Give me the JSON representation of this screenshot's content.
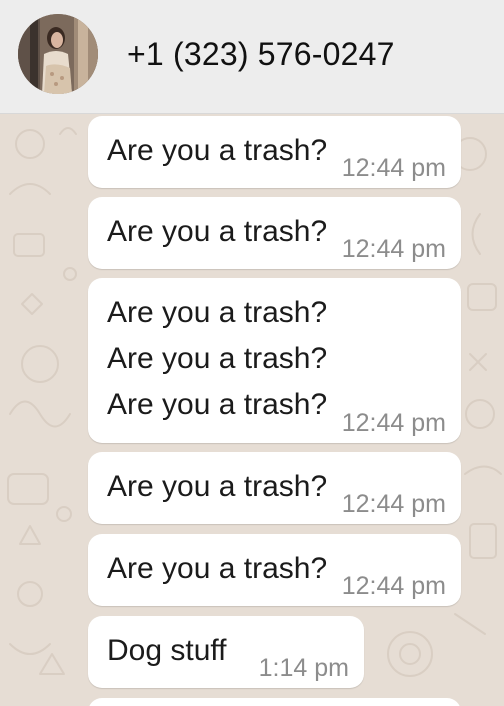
{
  "header": {
    "contact_name": "+1 (323) 576-0247"
  },
  "messages": [
    {
      "lines": [
        "Are you a trash?"
      ],
      "time": "12:44 pm"
    },
    {
      "lines": [
        "Are you a trash?"
      ],
      "time": "12:44 pm"
    },
    {
      "lines": [
        "Are you a trash?",
        "Are you a trash?",
        "Are you a trash?"
      ],
      "time": "12:44 pm"
    },
    {
      "lines": [
        "Are you a trash?"
      ],
      "time": "12:44 pm"
    },
    {
      "lines": [
        "Are you a trash?"
      ],
      "time": "12:44 pm"
    },
    {
      "lines": [
        "Dog stuff"
      ],
      "time": "1:14 pm"
    }
  ],
  "colors": {
    "header_bg": "#ededed",
    "chat_bg": "#e6ddd4",
    "bubble_bg": "#ffffff",
    "timestamp": "#8c8c8c"
  }
}
